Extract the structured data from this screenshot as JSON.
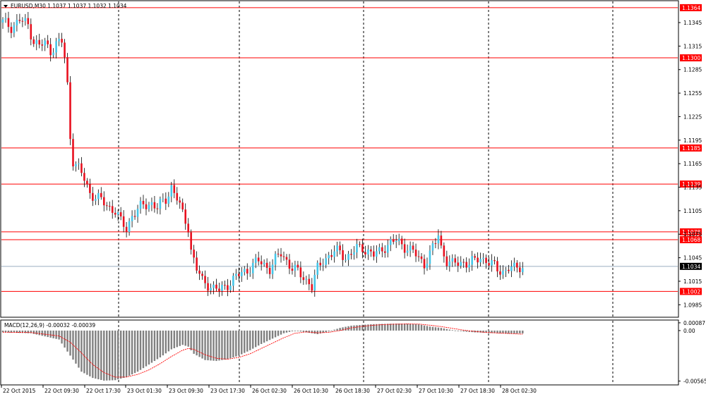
{
  "chart_data": [
    {
      "type": "candlestick",
      "title": "EURUSD,M30  1.1037 1.1037 1.1032 1.1034",
      "symbol": "EURUSD",
      "timeframe": "M30",
      "ohlc_header": "1.1037 1.1037 1.1032 1.1034",
      "ylim": [
        1.097,
        1.1372
      ],
      "y_ticks": [
        "1.1345",
        "1.1315",
        "1.1285",
        "1.1255",
        "1.1225",
        "1.1195",
        "1.1165",
        "1.1135",
        "1.1105",
        "1.1075",
        "1.1045",
        "1.1015",
        "1.0985"
      ],
      "x_ticks": [
        "22 Oct 2015",
        "22 Oct 09:30",
        "22 Oct 17:30",
        "23 Oct 01:30",
        "23 Oct 09:30",
        "23 Oct 17:30",
        "26 Oct 02:30",
        "26 Oct 10:30",
        "26 Oct 18:30",
        "27 Oct 02:30",
        "27 Oct 10:30",
        "27 Oct 18:30",
        "28 Oct 02:30"
      ],
      "horizontal_levels": [
        {
          "value": 1.1364,
          "label": "1.1364"
        },
        {
          "value": 1.13,
          "label": "1.1300"
        },
        {
          "value": 1.1185,
          "label": "1.1185"
        },
        {
          "value": 1.1139,
          "label": "1.1139"
        },
        {
          "value": 1.1078,
          "label": "1.1078"
        },
        {
          "value": 1.1068,
          "label": "1.1068"
        },
        {
          "value": 1.1002,
          "label": "1.1002"
        }
      ],
      "current_price": {
        "value": 1.1034,
        "label": "1.1034"
      },
      "vertical_markers": [
        "22 Oct 17:30",
        "23 Oct 17:30",
        "26 Oct 18:30",
        "27 Oct 18:30",
        "28 Oct 10:30"
      ],
      "price_path": [
        [
          0,
          1.1345
        ],
        [
          3,
          1.134
        ],
        [
          6,
          1.1348
        ],
        [
          9,
          1.1342
        ],
        [
          11,
          1.1322
        ],
        [
          13,
          1.1315
        ],
        [
          15,
          1.1318
        ],
        [
          17,
          1.131
        ],
        [
          19,
          1.1318
        ],
        [
          21,
          1.132
        ],
        [
          22,
          1.13
        ],
        [
          23,
          1.1265
        ],
        [
          24,
          1.12
        ],
        [
          25,
          1.117
        ],
        [
          27,
          1.1158
        ],
        [
          29,
          1.1145
        ],
        [
          31,
          1.1128
        ],
        [
          34,
          1.112
        ],
        [
          37,
          1.1112
        ],
        [
          40,
          1.1105
        ],
        [
          42,
          1.109
        ],
        [
          44,
          1.1082
        ],
        [
          46,
          1.11
        ],
        [
          48,
          1.1105
        ],
        [
          50,
          1.1112
        ],
        [
          53,
          1.1115
        ],
        [
          55,
          1.1108
        ],
        [
          58,
          1.112
        ],
        [
          60,
          1.1136
        ],
        [
          62,
          1.112
        ],
        [
          64,
          1.11
        ],
        [
          66,
          1.1085
        ],
        [
          67,
          1.1055
        ],
        [
          69,
          1.103
        ],
        [
          71,
          1.1015
        ],
        [
          73,
          1.1012
        ],
        [
          75,
          1.1006
        ],
        [
          77,
          1.1003
        ],
        [
          79,
          1.1008
        ],
        [
          81,
          1.1015
        ],
        [
          83,
          1.102
        ],
        [
          85,
          1.1025
        ],
        [
          87,
          1.103
        ],
        [
          89,
          1.1036
        ],
        [
          91,
          1.104
        ],
        [
          93,
          1.1036
        ],
        [
          95,
          1.1032
        ],
        [
          97,
          1.1042
        ],
        [
          99,
          1.105
        ],
        [
          101,
          1.1042
        ],
        [
          103,
          1.1032
        ],
        [
          105,
          1.1026
        ],
        [
          107,
          1.102
        ],
        [
          109,
          1.1014
        ],
        [
          110,
          1.1008
        ],
        [
          112,
          1.103
        ],
        [
          114,
          1.1042
        ],
        [
          116,
          1.1048
        ],
        [
          118,
          1.1052
        ],
        [
          120,
          1.1052
        ],
        [
          122,
          1.1046
        ],
        [
          124,
          1.105
        ],
        [
          126,
          1.1056
        ],
        [
          128,
          1.1058
        ],
        [
          130,
          1.1054
        ],
        [
          132,
          1.1048
        ],
        [
          134,
          1.1052
        ],
        [
          136,
          1.106
        ],
        [
          138,
          1.1064
        ],
        [
          140,
          1.1066
        ],
        [
          142,
          1.1062
        ],
        [
          144,
          1.1058
        ],
        [
          146,
          1.1052
        ],
        [
          148,
          1.1044
        ],
        [
          150,
          1.1038
        ],
        [
          152,
          1.105
        ],
        [
          154,
          1.1064
        ],
        [
          155,
          1.1074
        ],
        [
          156,
          1.1058
        ],
        [
          158,
          1.1042
        ],
        [
          160,
          1.1036
        ],
        [
          162,
          1.1038
        ],
        [
          164,
          1.104
        ],
        [
          166,
          1.1038
        ],
        [
          168,
          1.104
        ],
        [
          170,
          1.1046
        ],
        [
          172,
          1.1042
        ],
        [
          174,
          1.1036
        ],
        [
          176,
          1.103
        ],
        [
          178,
          1.1028
        ],
        [
          180,
          1.1032
        ],
        [
          182,
          1.103
        ],
        [
          184,
          1.1034
        ]
      ]
    },
    {
      "type": "histogram",
      "title": "MACD(12,26,9) -0.00032 -0.00039",
      "indicator": "MACD(12,26,9)",
      "values_label": "-0.00032 -0.00039",
      "ylim": [
        -0.006,
        0.0011
      ],
      "y_ticks": [
        "0.00087",
        "0.00",
        "-0.00565"
      ],
      "macd_path": [
        [
          0,
          -0.0002
        ],
        [
          10,
          -0.0003
        ],
        [
          20,
          -0.001
        ],
        [
          24,
          -0.0028
        ],
        [
          28,
          -0.0046
        ],
        [
          32,
          -0.0053
        ],
        [
          36,
          -0.0056
        ],
        [
          40,
          -0.00555
        ],
        [
          44,
          -0.0052
        ],
        [
          48,
          -0.0046
        ],
        [
          52,
          -0.0038
        ],
        [
          56,
          -0.003
        ],
        [
          60,
          -0.0021
        ],
        [
          64,
          -0.0016
        ],
        [
          66,
          -0.0018
        ],
        [
          68,
          -0.0026
        ],
        [
          72,
          -0.0033
        ],
        [
          76,
          -0.0034
        ],
        [
          80,
          -0.0032
        ],
        [
          84,
          -0.0028
        ],
        [
          88,
          -0.0022
        ],
        [
          92,
          -0.0015
        ],
        [
          96,
          -0.0009
        ],
        [
          100,
          -0.0003
        ],
        [
          104,
          0.0
        ],
        [
          108,
          -0.0002
        ],
        [
          112,
          -0.0004
        ],
        [
          116,
          -0.0001
        ],
        [
          120,
          0.0003
        ],
        [
          124,
          0.00055
        ],
        [
          128,
          0.00065
        ],
        [
          132,
          0.00072
        ],
        [
          136,
          0.00075
        ],
        [
          140,
          0.00078
        ],
        [
          144,
          0.00078
        ],
        [
          148,
          0.0007
        ],
        [
          152,
          0.00045
        ],
        [
          156,
          0.0003
        ],
        [
          160,
          5e-05
        ],
        [
          164,
          -0.0001
        ],
        [
          168,
          -0.0002
        ],
        [
          172,
          -0.00025
        ],
        [
          176,
          -0.0003
        ],
        [
          180,
          -0.00035
        ],
        [
          184,
          -0.00032
        ]
      ],
      "signal_path": [
        [
          0,
          -0.00018
        ],
        [
          10,
          -0.00022
        ],
        [
          20,
          -0.0006
        ],
        [
          24,
          -0.0013
        ],
        [
          28,
          -0.0025
        ],
        [
          32,
          -0.0038
        ],
        [
          36,
          -0.0047
        ],
        [
          40,
          -0.0052
        ],
        [
          44,
          -0.0052
        ],
        [
          48,
          -0.0049
        ],
        [
          52,
          -0.0044
        ],
        [
          56,
          -0.0037
        ],
        [
          60,
          -0.0029
        ],
        [
          64,
          -0.0022
        ],
        [
          66,
          -0.002
        ],
        [
          68,
          -0.0021
        ],
        [
          72,
          -0.0027
        ],
        [
          76,
          -0.0031
        ],
        [
          80,
          -0.0032
        ],
        [
          84,
          -0.003
        ],
        [
          88,
          -0.0026
        ],
        [
          92,
          -0.002
        ],
        [
          96,
          -0.0014
        ],
        [
          100,
          -0.0008
        ],
        [
          104,
          -0.0003
        ],
        [
          108,
          -0.00015
        ],
        [
          112,
          -0.00025
        ],
        [
          116,
          -0.0002
        ],
        [
          120,
          0.0
        ],
        [
          124,
          0.0003
        ],
        [
          128,
          0.00048
        ],
        [
          132,
          0.0006
        ],
        [
          136,
          0.00068
        ],
        [
          140,
          0.00072
        ],
        [
          144,
          0.00074
        ],
        [
          148,
          0.00073
        ],
        [
          152,
          0.0006
        ],
        [
          156,
          0.00045
        ],
        [
          160,
          0.00025
        ],
        [
          164,
          5e-05
        ],
        [
          168,
          -0.0001
        ],
        [
          172,
          -0.0002
        ],
        [
          176,
          -0.00027
        ],
        [
          180,
          -0.00032
        ],
        [
          184,
          -0.00039
        ]
      ]
    }
  ]
}
